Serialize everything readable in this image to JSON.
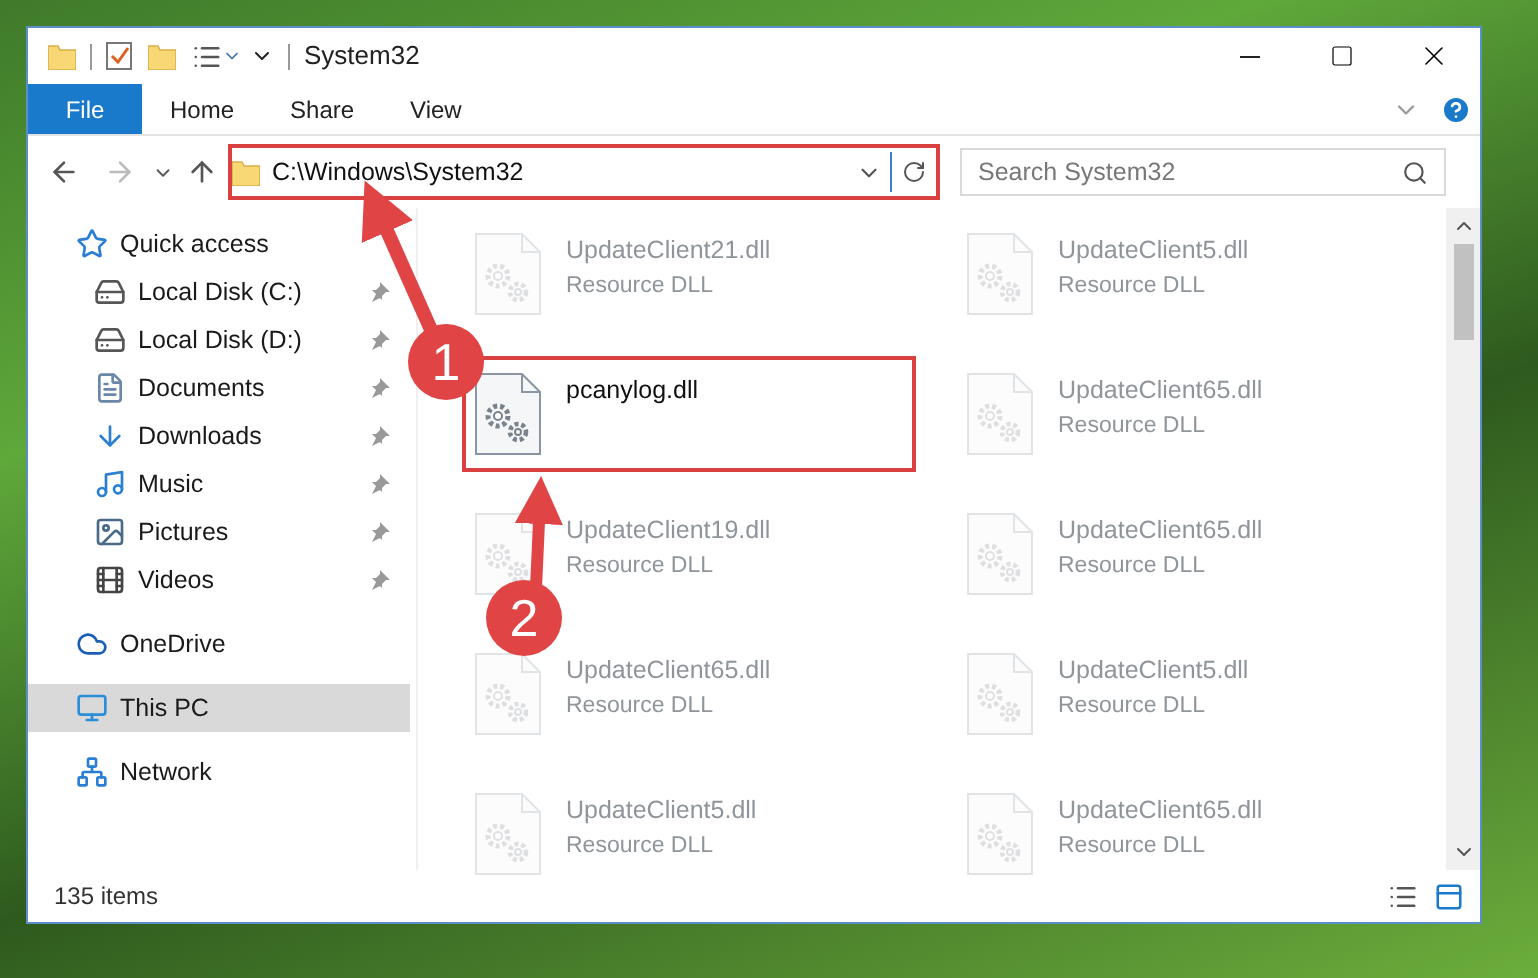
{
  "window": {
    "title": "System32"
  },
  "ribbon_tabs": [
    {
      "label": "File",
      "selected": true
    },
    {
      "label": "Home",
      "selected": false
    },
    {
      "label": "Share",
      "selected": false
    },
    {
      "label": "View",
      "selected": false
    }
  ],
  "address_bar": {
    "path": "C:\\Windows\\System32",
    "highlighted": true
  },
  "search": {
    "placeholder": "Search System32"
  },
  "sidebar": {
    "items": [
      {
        "label": "Quick access",
        "kind": "star",
        "selected": false,
        "children": [
          {
            "label": "Local Disk (C:)",
            "kind": "system-drive",
            "pinned": true,
            "selected": false
          },
          {
            "label": "Local Disk (D:)",
            "kind": "drive",
            "pinned": true,
            "selected": false
          },
          {
            "label": "Documents",
            "kind": "documents",
            "pinned": true,
            "selected": false
          },
          {
            "label": "Downloads",
            "kind": "downloads",
            "pinned": true,
            "selected": false
          },
          {
            "label": "Music",
            "kind": "music",
            "pinned": true,
            "selected": false
          },
          {
            "label": "Pictures",
            "kind": "pictures",
            "pinned": true,
            "selected": false
          },
          {
            "label": "Videos",
            "kind": "videos",
            "pinned": true,
            "selected": false
          }
        ]
      },
      {
        "label": "OneDrive",
        "kind": "cloud",
        "selected": false
      },
      {
        "label": "This PC",
        "kind": "pc",
        "selected": true
      },
      {
        "label": "Network",
        "kind": "network",
        "selected": false
      }
    ]
  },
  "files": [
    {
      "name": "UpdateClient21.dll",
      "type": "Resource DLL",
      "dimmed": true,
      "highlighted": false
    },
    {
      "name": "UpdateClient5.dll",
      "type": "Resource DLL",
      "dimmed": true,
      "highlighted": false
    },
    {
      "name": "pcanylog.dll",
      "dimmed": false,
      "highlighted": true
    },
    {
      "name": "UpdateClient65.dll",
      "type": "Resource DLL",
      "dimmed": true,
      "highlighted": false
    },
    {
      "name": "UpdateClient19.dll",
      "type": "Resource DLL",
      "dimmed": true,
      "highlighted": false
    },
    {
      "name": "UpdateClient65.dll",
      "type": "Resource DLL",
      "dimmed": true,
      "highlighted": false
    },
    {
      "name": "UpdateClient65.dll",
      "type": "Resource DLL",
      "dimmed": true,
      "highlighted": false
    },
    {
      "name": "UpdateClient5.dll",
      "type": "Resource DLL",
      "dimmed": true,
      "highlighted": false
    },
    {
      "name": "UpdateClient5.dll",
      "type": "Resource DLL",
      "dimmed": true,
      "highlighted": false
    },
    {
      "name": "UpdateClient65.dll",
      "type": "Resource DLL",
      "dimmed": true,
      "highlighted": false
    }
  ],
  "status_bar": {
    "item_count": "135 items"
  },
  "callouts": [
    {
      "number": "1"
    },
    {
      "number": "2"
    }
  ]
}
